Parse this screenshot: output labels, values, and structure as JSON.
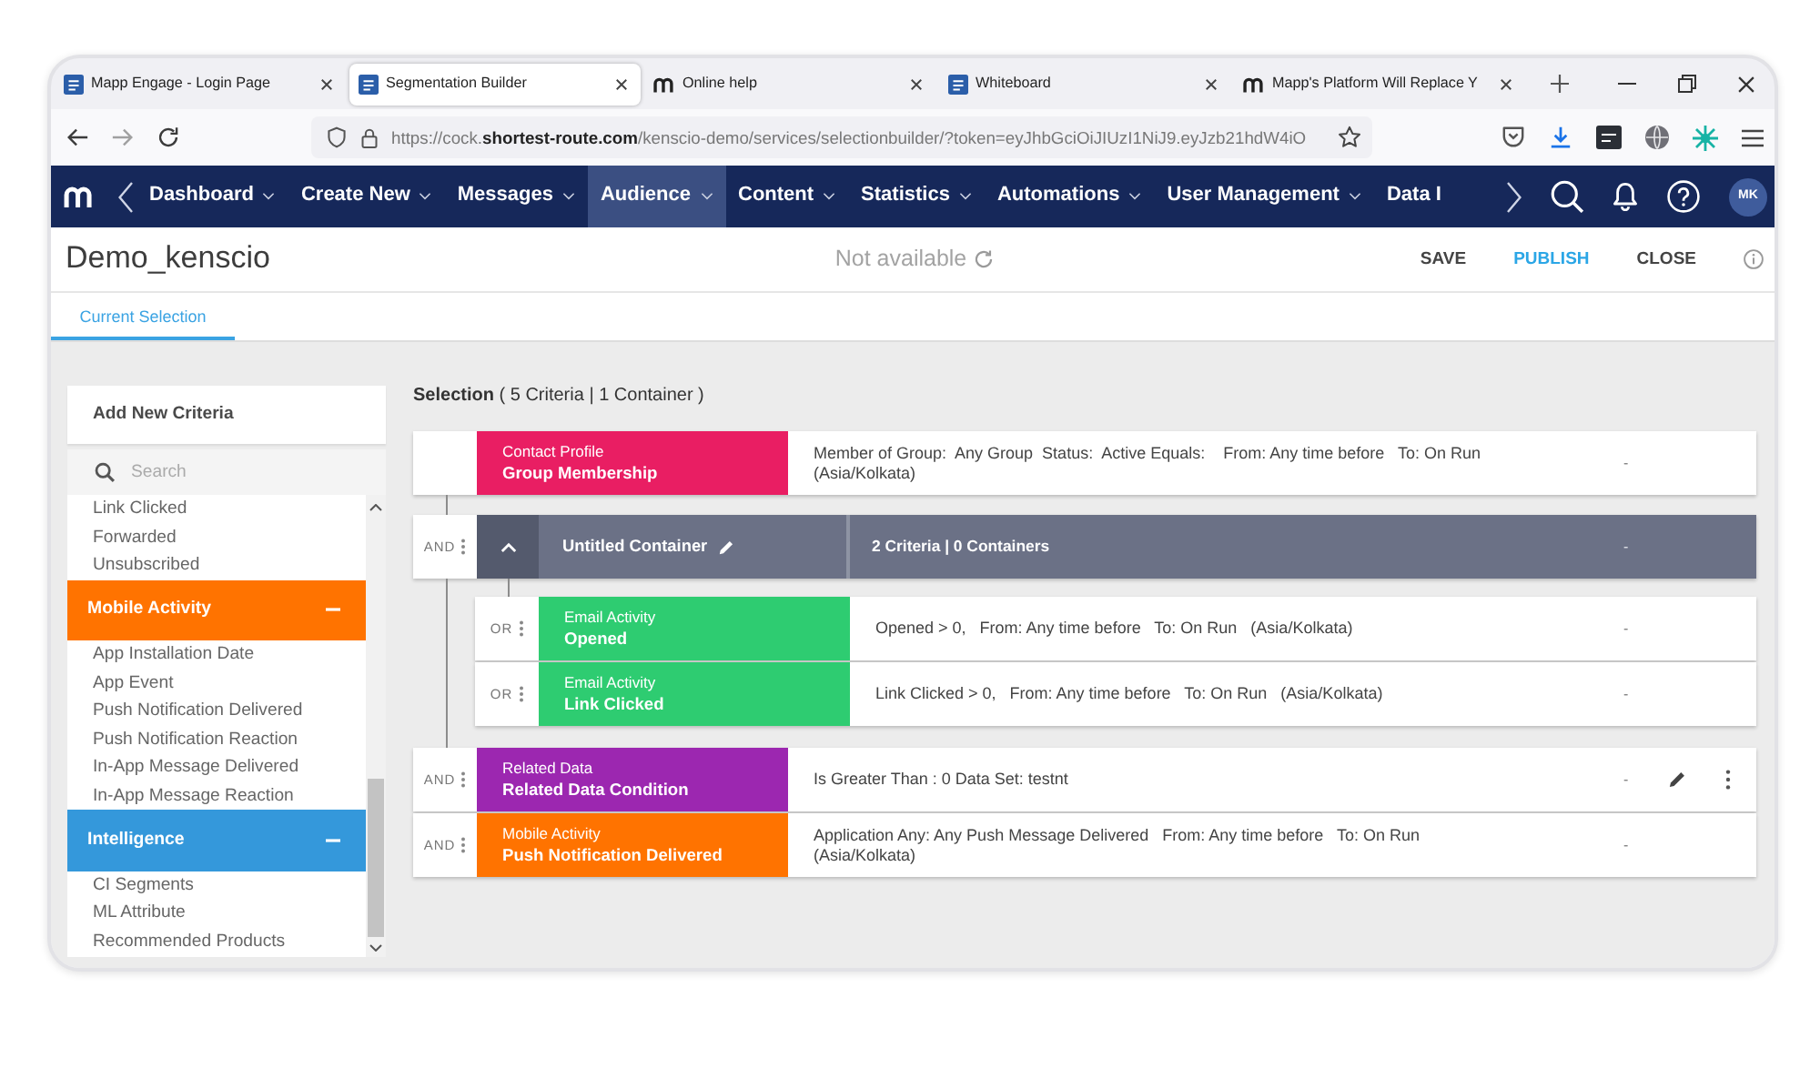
{
  "browser": {
    "tabs": [
      {
        "title": "Mapp Engage - Login Page",
        "kind": "tile",
        "selected": false
      },
      {
        "title": "Segmentation Builder",
        "kind": "tile",
        "selected": true
      },
      {
        "title": "Online help",
        "kind": "logo",
        "selected": false
      },
      {
        "title": "Whiteboard",
        "kind": "tile",
        "selected": false
      },
      {
        "title": "Mapp's Platform Will Replace Y",
        "kind": "logo",
        "selected": false
      }
    ],
    "address": "https://cock.**shortest-route.com**/kenscio-demo/services/selectionbuilder/?token=eyJhbGciOiJIUzI1NiJ9.eyJzb21hdW4iO"
  },
  "navbar": {
    "items": [
      {
        "label": "Dashboard",
        "selected": false,
        "caret": true
      },
      {
        "label": "Create New",
        "selected": false,
        "caret": true
      },
      {
        "label": "Messages",
        "selected": false,
        "caret": true
      },
      {
        "label": "Audience",
        "selected": true,
        "caret": true
      },
      {
        "label": "Content",
        "selected": false,
        "caret": true
      },
      {
        "label": "Statistics",
        "selected": false,
        "caret": true
      },
      {
        "label": "Automations",
        "selected": false,
        "caret": true
      },
      {
        "label": "User Management",
        "selected": false,
        "caret": true
      },
      {
        "label": "Data I",
        "selected": false,
        "caret": false
      }
    ],
    "avatar": "MK"
  },
  "header": {
    "title": "Demo_kenscio",
    "status": "Not available",
    "actions": [
      {
        "label": "SAVE",
        "kind": "plain"
      },
      {
        "label": "PUBLISH",
        "kind": "primary"
      },
      {
        "label": "CLOSE",
        "kind": "plain"
      }
    ]
  },
  "subtabs": [
    {
      "label": "Current Selection",
      "selected": true
    }
  ],
  "sidebar": {
    "add_button": "Add New Criteria",
    "search": {
      "placeholder": "Search"
    },
    "items": [
      {
        "kind": "item",
        "label": "Link Clicked"
      },
      {
        "kind": "item",
        "label": "Forwarded"
      },
      {
        "kind": "item",
        "label": "Unsubscribed"
      },
      {
        "kind": "group",
        "label": "Mobile Activity",
        "color": "#ff7300",
        "expanded": true,
        "children": [
          {
            "label": "App Installation Date"
          },
          {
            "label": "App Event"
          },
          {
            "label": "Push Notification Delivered"
          },
          {
            "label": "Push Notification Reaction"
          },
          {
            "label": "In-App Message Delivered"
          },
          {
            "label": "In-App Message Reaction"
          }
        ]
      },
      {
        "kind": "group",
        "label": "Intelligence",
        "color": "#3498db",
        "expanded": true,
        "children": [
          {
            "label": "CI Segments"
          },
          {
            "label": "ML Attribute"
          },
          {
            "label": "Recommended Products"
          }
        ]
      }
    ]
  },
  "selection": {
    "heading": "**Selection** ( 5 Criteria | 1 Container )",
    "rows": [
      {
        "kind": "criterion",
        "category": "Contact Profile",
        "name": "Group Membership",
        "color": "#e91e63",
        "description": "Member of Group:  Any Group  Status:  Active Equals:    From: Any time before   To: On Run (Asia/Kolkata)",
        "result": "-",
        "hovered": false
      },
      {
        "kind": "container",
        "operator": "AND",
        "expanded": true,
        "name": "Untitled Container",
        "summary": "2 Criteria | 0 Containers",
        "result": "-",
        "children": [
          {
            "kind": "criterion",
            "operator": "OR",
            "category": "Email Activity",
            "name": "Opened",
            "color": "#2ecc71",
            "description": "Opened > 0,   From: Any time before   To: On Run   (Asia/Kolkata)",
            "result": "-",
            "hovered": false
          },
          {
            "kind": "criterion",
            "operator": "OR",
            "category": "Email Activity",
            "name": "Link Clicked",
            "color": "#2ecc71",
            "description": "Link Clicked > 0,   From: Any time before   To: On Run   (Asia/Kolkata)",
            "result": "-",
            "hovered": false
          }
        ]
      },
      {
        "kind": "criterion",
        "operator": "AND",
        "category": "Related Data",
        "name": "Related Data Condition",
        "color": "#9c27b0",
        "description": "Is Greater Than : 0 Data Set: testnt",
        "result": "-",
        "hovered": true
      },
      {
        "kind": "criterion",
        "operator": "AND",
        "category": "Mobile Activity",
        "name": "Push Notification Delivered",
        "color": "#ff7300",
        "description": "Application Any: Any Push Message Delivered   From: Any time before   To: On Run (Asia/Kolkata)",
        "result": "-",
        "hovered": false
      }
    ]
  }
}
